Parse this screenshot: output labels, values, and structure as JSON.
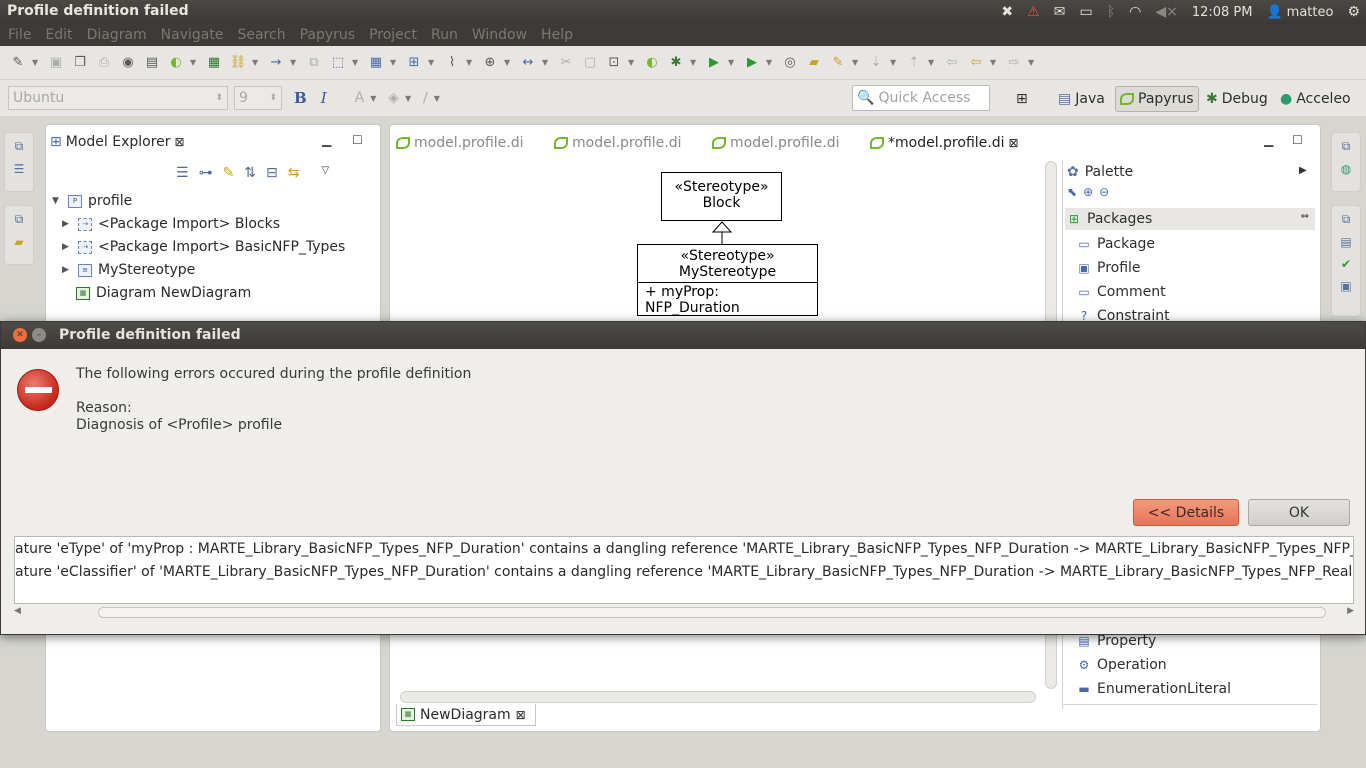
{
  "topbar": {
    "window_title": "Profile definition failed",
    "clock": "12:08 PM",
    "user": "matteo"
  },
  "menu": [
    "File",
    "Edit",
    "Diagram",
    "Navigate",
    "Search",
    "Papyrus",
    "Project",
    "Run",
    "Window",
    "Help"
  ],
  "format_toolbar": {
    "font_name": "Ubuntu",
    "font_size": "9",
    "bold": "B",
    "italic": "I",
    "quick_access_placeholder": "Quick Access"
  },
  "perspectives": [
    "Java",
    "Papyrus",
    "Debug",
    "Acceleo"
  ],
  "explorer": {
    "tab_label": "Model Explorer",
    "tree": [
      {
        "label": "profile",
        "expanded": true
      },
      {
        "label": "<Package Import> Blocks"
      },
      {
        "label": "<Package Import> BasicNFP_Types"
      },
      {
        "label": "MyStereotype"
      },
      {
        "label": "Diagram NewDiagram"
      }
    ]
  },
  "editor": {
    "tabs": [
      "model.profile.di",
      "model.profile.di",
      "model.profile.di",
      "*model.profile.di"
    ],
    "diagram_tab": "NewDiagram",
    "block": {
      "stereotype": "«Stereotype»",
      "name": "Block"
    },
    "my_stereotype": {
      "stereotype": "«Stereotype»",
      "name": "MyStereotype",
      "attribute": "+ myProp: NFP_Duration"
    }
  },
  "palette": {
    "title": "Palette",
    "drawer": "Packages",
    "items_top": [
      "Package",
      "Profile",
      "Comment",
      "Constraint"
    ],
    "items_bottom": [
      "Property",
      "Operation",
      "EnumerationLiteral"
    ]
  },
  "dialog": {
    "title": "Profile definition failed",
    "message": "The following errors occured during the profile definition",
    "reason_label": "Reason:",
    "reason": "Diagnosis of <Profile> profile",
    "details_button": "<< Details",
    "ok_button": "OK",
    "details": [
      "ature 'eType' of 'myProp : MARTE_Library_BasicNFP_Types_NFP_Duration' contains a dangling reference 'MARTE_Library_BasicNFP_Types_NFP_Duration -> MARTE_Library_BasicNFP_Types_NFP_Real'",
      "ature 'eClassifier' of 'MARTE_Library_BasicNFP_Types_NFP_Duration' contains a dangling reference 'MARTE_Library_BasicNFP_Types_NFP_Duration -> MARTE_Library_BasicNFP_Types_NFP_Real'"
    ]
  }
}
